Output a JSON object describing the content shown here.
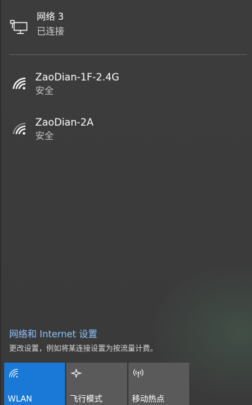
{
  "connected_network": {
    "name": "网络 3",
    "status": "已连接",
    "icon": "ethernet-network-icon"
  },
  "wifi_networks": [
    {
      "name": "ZaoDian-1F-2.4G",
      "security": "安全",
      "icon": "wifi-signal-icon"
    },
    {
      "name": "ZaoDian-2A",
      "security": "安全",
      "icon": "wifi-signal-icon"
    }
  ],
  "settings": {
    "link": "网络和 Internet 设置",
    "description": "更改设置，例如将某连接设置为按流量计费。"
  },
  "quick_actions": [
    {
      "label": "WLAN",
      "icon": "wifi-icon",
      "active": true
    },
    {
      "label": "飞行模式",
      "icon": "airplane-icon",
      "active": false
    },
    {
      "label": "移动热点",
      "icon": "hotspot-icon",
      "active": false
    }
  ],
  "colors": {
    "background": "#3b3b3b",
    "accent": "#1a79d6",
    "link": "#8fc3ff",
    "tile_inactive": "#5a5a5a"
  }
}
